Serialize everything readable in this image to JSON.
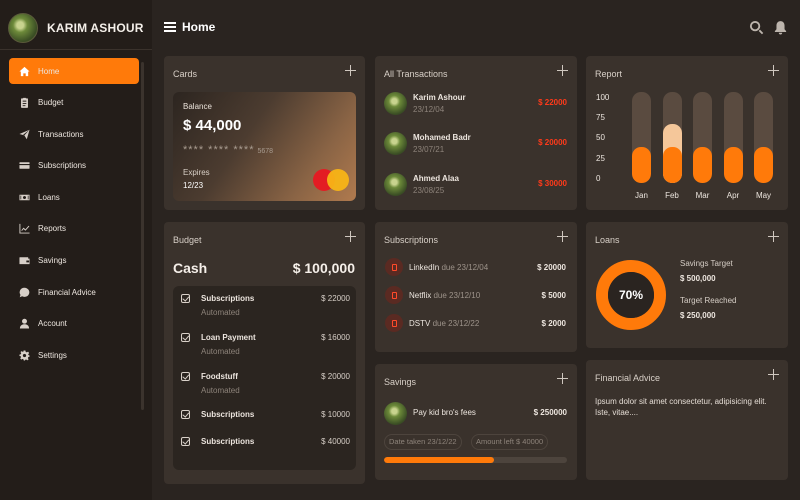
{
  "profile": {
    "name": "KARIM ASHOUR"
  },
  "header": {
    "title": "Home"
  },
  "sidebar": {
    "items": [
      {
        "label": "Home",
        "icon": "home-icon",
        "active": true
      },
      {
        "label": "Budget",
        "icon": "clipboard-icon"
      },
      {
        "label": "Transactions",
        "icon": "send-icon"
      },
      {
        "label": "Subscriptions",
        "icon": "card-icon"
      },
      {
        "label": "Loans",
        "icon": "money-icon"
      },
      {
        "label": "Reports",
        "icon": "chart-line-icon"
      },
      {
        "label": "Savings",
        "icon": "wallet-icon"
      },
      {
        "label": "Financial Advice",
        "icon": "chat-dollar-icon"
      },
      {
        "label": "Account",
        "icon": "user-icon"
      },
      {
        "label": "Settings",
        "icon": "gear-icon"
      }
    ]
  },
  "cards": {
    "title": "Cards",
    "balance_label": "Balance",
    "balance": "$ 44,000",
    "number_masked": "**** **** ****",
    "number_last": "5678",
    "expires_label": "Expires",
    "expires": "12/23"
  },
  "budget": {
    "title": "Budget",
    "cash_label": "Cash",
    "cash_value": "$ 100,000",
    "items": [
      {
        "name": "Subscriptions",
        "sub": "Automated",
        "amount": "$ 22000"
      },
      {
        "name": "Loan Payment",
        "sub": "Automated",
        "amount": "$ 16000"
      },
      {
        "name": "Foodstuff",
        "sub": "Automated",
        "amount": "$ 20000"
      },
      {
        "name": "Subscriptions",
        "sub": "",
        "amount": "$ 10000"
      },
      {
        "name": "Subscriptions",
        "sub": "",
        "amount": "$ 40000"
      }
    ]
  },
  "transactions": {
    "title": "All Transactions",
    "items": [
      {
        "name": "Karim Ashour",
        "date": "23/12/04",
        "amount": "$ 22000"
      },
      {
        "name": "Mohamed Badr",
        "date": "23/07/21",
        "amount": "$ 20000"
      },
      {
        "name": "Ahmed Alaa",
        "date": "23/08/25",
        "amount": "$ 30000"
      }
    ]
  },
  "subscriptions": {
    "title": "Subscriptions",
    "items": [
      {
        "name": "LinkedIn",
        "due": "due 23/12/04",
        "amount": "$ 20000"
      },
      {
        "name": "Netflix",
        "due": "due 23/12/10",
        "amount": "$ 5000"
      },
      {
        "name": "DSTV",
        "due": "due 23/12/22",
        "amount": "$ 2000"
      }
    ]
  },
  "savings": {
    "title": "Savings",
    "name": "Pay kid bro's fees",
    "amount": "$ 250000",
    "date_taken": "Date taken 23/12/22",
    "amount_left": "Amount left $ 40000",
    "progress": 0.6
  },
  "report": {
    "title": "Report",
    "y_ticks": [
      "100",
      "75",
      "50",
      "25",
      "0"
    ],
    "months": [
      "Jan",
      "Feb",
      "Mar",
      "Apr",
      "May"
    ],
    "values": [
      40,
      40,
      40,
      40,
      40
    ],
    "highlight": [
      0,
      65,
      0,
      0,
      0
    ]
  },
  "loans": {
    "title": "Loans",
    "percent_label": "70%",
    "percent": 0.7,
    "target_label": "Savings Target",
    "target_value": "$ 500,000",
    "reached_label": "Target Reached",
    "reached_value": "$ 250,000"
  },
  "advice": {
    "title": "Financial Advice",
    "text": "Ipsum dolor sit amet consectetur, adipisicing elit. Iste, vitae...."
  },
  "colors": {
    "accent": "#ff7a0a",
    "negative": "#ff3a1a",
    "background": "#2a2420",
    "card": "#3a322c"
  }
}
